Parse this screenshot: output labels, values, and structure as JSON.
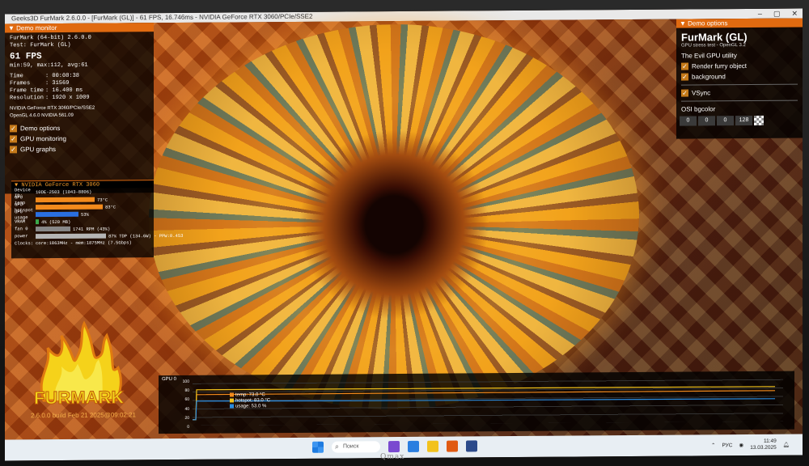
{
  "window": {
    "title": "Geeks3D FurMark 2.6.0.0 - [FurMark (GL)] - 61 FPS, 16.746ms - NVIDIA GeForce RTX 3060/PCIe/SSE2",
    "minimize": "–",
    "maximize": "▢",
    "close": "✕"
  },
  "monitor": {
    "header": "Demo monitor",
    "app": "FurMark (64-bit) 2.6.0.0",
    "test": "Test: FurMark (GL)",
    "fps": "61 FPS",
    "minmax": "min:59, max:112, avg:61",
    "rows": [
      {
        "k": "Time",
        "v": ": 00:08:38"
      },
      {
        "k": "Frames",
        "v": ": 31569"
      },
      {
        "k": "Frame time",
        "v": ": 16.400 ms"
      },
      {
        "k": "Resolution",
        "v": ": 1920 x 1009"
      }
    ],
    "gpu_line": "NVIDIA GeForce RTX 3060/PCIe/SSE2",
    "gl_line": "OpenGL 4.6.0 NVIDIA 561.09",
    "options": [
      "Demo options",
      "GPU monitoring",
      "GPU graphs"
    ]
  },
  "gpu": {
    "header": "NVIDIA GeForce RTX 3060",
    "device": "Device ID:",
    "device_val": "10DE-2503 (1043-8806)",
    "rows": [
      {
        "k": "GPU temp",
        "v": "73°C",
        "pct": 0.73,
        "color": "#f28a1c"
      },
      {
        "k": "GPU hotspot",
        "v": "83°C",
        "pct": 0.83,
        "color": "#f28a1c"
      },
      {
        "k": "GPU usage",
        "v": "53%",
        "pct": 0.53,
        "color": "#2a6fe0"
      },
      {
        "k": "VRAM",
        "v": "4% (520 MB)",
        "pct": 0.04,
        "color": "#3aa84a"
      },
      {
        "k": "fan 0",
        "v": "1741 RPM (43%)",
        "pct": 0.43,
        "color": "#888888"
      },
      {
        "k": "power",
        "v": "87% TDP (134.6W) - PPW:0.453",
        "pct": 0.87,
        "color": "#b5b5b5"
      },
      {
        "k": "Clocks:",
        "v": "core:1863MHz - mem:1875MHz (7.5Gbps)",
        "pct": 0,
        "color": "#000000"
      }
    ]
  },
  "logo": {
    "text": "FURMARK",
    "build": "2.6.0.0 build Feb 21 2025@09:02:21"
  },
  "options": {
    "header": "Demo options",
    "title": "FurMark (GL)",
    "subtitle": "GPU stress test - OpenGL 3.2",
    "tagline": "The Evil GPU utility",
    "render": "Render furry object",
    "background": "background",
    "vsync": "VSync",
    "bgcolor_label": "OSI bgcolor",
    "bgcolor": [
      "0",
      "0",
      "0",
      "128"
    ]
  },
  "graph": {
    "label": "GPU 0",
    "y_ticks": [
      "100",
      "80",
      "60",
      "40",
      "20",
      "0"
    ],
    "legend": [
      {
        "name": "temp: 73.0 °C",
        "color": "#f28a1c"
      },
      {
        "name": "hotspot: 83.0 °C",
        "color": "#f2c31c"
      },
      {
        "name": "usage: 53.0 %",
        "color": "#2a8ce0"
      }
    ]
  },
  "taskbar": {
    "search": "Поиск",
    "lang": "РУС",
    "time": "11:49",
    "date": "13.03.2025"
  },
  "brand": "Qmax",
  "colors": {
    "accent": "#e06a10",
    "panel": "#000000"
  }
}
